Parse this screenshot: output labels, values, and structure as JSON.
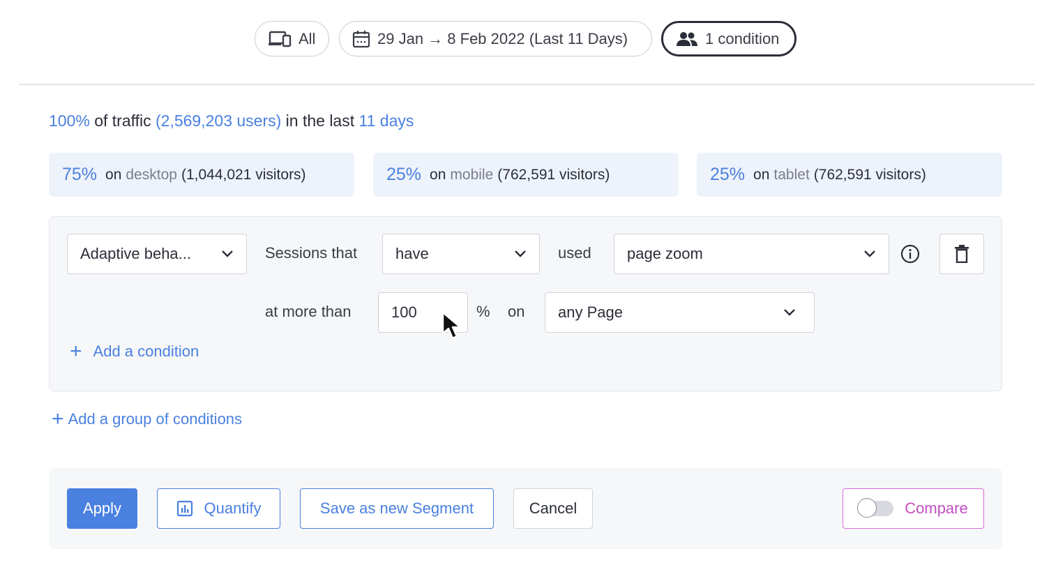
{
  "filters": {
    "device_label": "All",
    "date_range": "29 Jan → 8 Feb 2022 (Last 11 Days)",
    "segment_label": "1 condition"
  },
  "traffic": {
    "percent": "100%",
    "of_traffic_text": "of traffic",
    "users": "(2,569,203 users)",
    "in_last_text": "in the last",
    "period": "11 days"
  },
  "devices": [
    {
      "percent": "75%",
      "on": "on",
      "device": "desktop",
      "visitors": "(1,044,021 visitors)"
    },
    {
      "percent": "25%",
      "on": "on",
      "device": "mobile",
      "visitors": "(762,591 visitors)"
    },
    {
      "percent": "25%",
      "on": "on",
      "device": "tablet",
      "visitors": "(762,591 visitors)"
    }
  ],
  "condition": {
    "category": "Adaptive beha...",
    "sessions_that_label": "Sessions that",
    "have_value": "have",
    "used_label": "used",
    "behavior": "page zoom",
    "at_more_than_label": "at more than",
    "threshold": "100",
    "unit": "%",
    "on_label": "on",
    "page": "any Page"
  },
  "add_condition": "Add a condition",
  "add_group": "Add a group of conditions",
  "actions": {
    "apply": "Apply",
    "quantify": "Quantify",
    "save_segment": "Save as new Segment",
    "cancel": "Cancel",
    "compare": "Compare"
  },
  "colors": {
    "accent": "#4a80e0",
    "compare": "#c24fc2",
    "stat_bg": "#eef3fb"
  }
}
